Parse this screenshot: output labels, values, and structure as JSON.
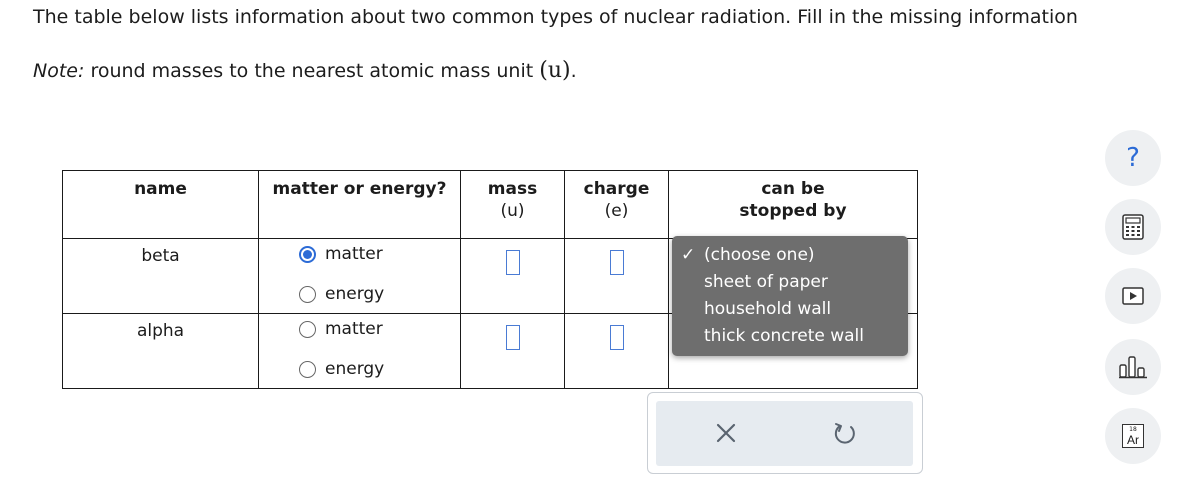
{
  "question": {
    "intro": "The table below lists information about two common types of nuclear radiation. Fill in the missing information",
    "note_label": "Note:",
    "note_text": "round masses to the nearest atomic mass unit",
    "note_unit": "(u)",
    "note_end": "."
  },
  "table": {
    "headers": {
      "name": "name",
      "matter_or_energy": "matter or energy?",
      "mass": "mass",
      "mass_unit": "(u)",
      "charge": "charge",
      "charge_unit": "(e)",
      "stopped_line1": "can be",
      "stopped_line2": "stopped by"
    },
    "rows": [
      {
        "name": "beta",
        "option_matter": "matter",
        "option_energy": "energy",
        "selected": "matter"
      },
      {
        "name": "alpha",
        "option_matter": "matter",
        "option_energy": "energy",
        "selected": ""
      }
    ]
  },
  "dropdown": {
    "check": "✓",
    "options": [
      "(choose one)",
      "sheet of paper",
      "household wall",
      "thick concrete wall"
    ],
    "selected": "(choose one)"
  },
  "actions": {
    "clear_icon": "x-icon",
    "undo_icon": "undo-icon"
  },
  "tools": {
    "help": "?",
    "calculator_icon": "calculator-icon",
    "video_icon": "play-icon",
    "chart_icon": "bar-chart-icon",
    "periodic": {
      "number": "18",
      "symbol": "Ar"
    }
  },
  "colors": {
    "accent": "#2c6bd6",
    "dropdown_bg": "#6e6e6e",
    "action_bar_bg": "#e6ebf0"
  }
}
